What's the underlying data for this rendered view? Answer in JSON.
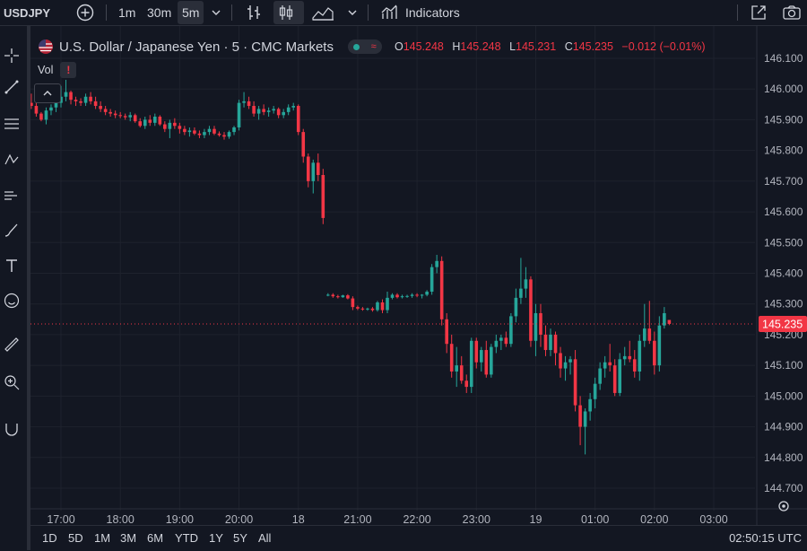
{
  "toolbar": {
    "symbol": "USDJPY",
    "intervals": [
      "1m",
      "30m",
      "5m"
    ],
    "active_interval": "5m",
    "indicators_label": "Indicators"
  },
  "legend": {
    "title": "U.S. Dollar / Japanese Yen · 5 · CMC Markets",
    "o_label": "O",
    "o": "145.248",
    "h_label": "H",
    "h": "145.248",
    "l_label": "L",
    "l": "145.231",
    "c_label": "C",
    "c": "145.235",
    "change": "−0.012 (−0.01%)",
    "vol_label": "Vol",
    "vol_alert": "!"
  },
  "bottom": {
    "ranges": [
      "1D",
      "5D",
      "1M",
      "3M",
      "6M",
      "YTD",
      "1Y",
      "5Y",
      "All"
    ],
    "clock": "02:50:15 UTC"
  },
  "colors": {
    "up": "#26a69a",
    "down": "#f23645",
    "background": "#131722",
    "grid": "#1e222d",
    "price_line": "#f23645"
  },
  "chart_data": {
    "type": "candlestick",
    "ylim": [
      144.7,
      146.1
    ],
    "yticks": [
      "146.100",
      "146.000",
      "145.900",
      "145.800",
      "145.700",
      "145.600",
      "145.500",
      "145.400",
      "145.300",
      "145.200",
      "145.100",
      "145.000",
      "144.900",
      "144.800",
      "144.700"
    ],
    "xticks": [
      "17:00",
      "18:00",
      "19:00",
      "20:00",
      "18",
      "21:00",
      "22:00",
      "23:00",
      "19",
      "01:00",
      "02:00",
      "03:00"
    ],
    "last_price": "145.235",
    "candles": [
      [
        "16:30",
        145.955,
        145.985,
        145.935,
        145.945
      ],
      [
        "16:35",
        145.945,
        145.96,
        145.91,
        145.92
      ],
      [
        "16:40",
        145.92,
        145.925,
        145.895,
        145.9
      ],
      [
        "16:45",
        145.9,
        145.94,
        145.885,
        145.93
      ],
      [
        "16:50",
        145.93,
        145.95,
        145.915,
        145.94
      ],
      [
        "16:55",
        145.94,
        145.965,
        145.925,
        145.955
      ],
      [
        "17:00",
        145.955,
        146.01,
        145.94,
        145.975
      ],
      [
        "17:05",
        145.975,
        146.03,
        145.96,
        145.99
      ],
      [
        "17:10",
        145.99,
        145.995,
        145.95,
        145.965
      ],
      [
        "17:15",
        145.965,
        145.975,
        145.945,
        145.96
      ],
      [
        "17:20",
        145.96,
        145.97,
        145.945,
        145.955
      ],
      [
        "17:25",
        145.955,
        145.985,
        145.945,
        145.975
      ],
      [
        "17:30",
        145.975,
        145.99,
        145.95,
        145.96
      ],
      [
        "17:35",
        145.96,
        145.975,
        145.935,
        145.945
      ],
      [
        "17:40",
        145.945,
        145.96,
        145.925,
        145.935
      ],
      [
        "17:45",
        145.935,
        145.945,
        145.915,
        145.925
      ],
      [
        "17:50",
        145.925,
        145.935,
        145.91,
        145.92
      ],
      [
        "17:55",
        145.92,
        145.93,
        145.905,
        145.915
      ],
      [
        "18:00",
        145.915,
        145.925,
        145.905,
        145.912
      ],
      [
        "18:05",
        145.912,
        145.92,
        145.9,
        145.908
      ],
      [
        "18:10",
        145.908,
        145.925,
        145.895,
        145.915
      ],
      [
        "18:15",
        145.915,
        145.92,
        145.89,
        145.895
      ],
      [
        "18:20",
        145.895,
        145.905,
        145.875,
        145.88
      ],
      [
        "18:25",
        145.88,
        145.91,
        145.87,
        145.9
      ],
      [
        "18:30",
        145.9,
        145.915,
        145.88,
        145.89
      ],
      [
        "18:35",
        145.89,
        145.92,
        145.88,
        145.91
      ],
      [
        "18:40",
        145.91,
        145.915,
        145.88,
        145.885
      ],
      [
        "18:45",
        145.885,
        145.895,
        145.86,
        145.87
      ],
      [
        "18:50",
        145.87,
        145.9,
        145.84,
        145.89
      ],
      [
        "18:55",
        145.89,
        145.905,
        145.87,
        145.88
      ],
      [
        "19:00",
        145.88,
        145.89,
        145.855,
        145.87
      ],
      [
        "19:05",
        145.87,
        145.88,
        145.85,
        145.86
      ],
      [
        "19:10",
        145.86,
        145.875,
        145.845,
        145.865
      ],
      [
        "19:15",
        145.865,
        145.875,
        145.85,
        145.855
      ],
      [
        "19:20",
        145.855,
        145.865,
        145.84,
        145.85
      ],
      [
        "19:25",
        145.85,
        145.87,
        145.84,
        145.86
      ],
      [
        "19:30",
        145.86,
        145.88,
        145.85,
        145.87
      ],
      [
        "19:35",
        145.87,
        145.88,
        145.85,
        145.855
      ],
      [
        "19:40",
        145.855,
        145.862,
        145.845,
        145.85
      ],
      [
        "19:45",
        145.85,
        145.86,
        145.835,
        145.845
      ],
      [
        "19:50",
        145.845,
        145.865,
        145.838,
        145.86
      ],
      [
        "19:55",
        145.86,
        145.88,
        145.85,
        145.875
      ],
      [
        "20:00",
        145.875,
        145.965,
        145.865,
        145.955
      ],
      [
        "20:05",
        145.955,
        145.99,
        145.94,
        145.96
      ],
      [
        "20:10",
        145.96,
        145.975,
        145.935,
        145.945
      ],
      [
        "20:15",
        145.945,
        145.96,
        145.91,
        145.92
      ],
      [
        "20:20",
        145.92,
        145.945,
        145.9,
        145.935
      ],
      [
        "20:25",
        145.935,
        145.95,
        145.915,
        145.925
      ],
      [
        "20:30",
        145.925,
        145.94,
        145.91,
        145.93
      ],
      [
        "20:35",
        145.93,
        145.945,
        145.92,
        145.935
      ],
      [
        "20:40",
        145.935,
        145.94,
        145.905,
        145.915
      ],
      [
        "20:45",
        145.915,
        145.935,
        145.905,
        145.925
      ],
      [
        "20:50",
        145.925,
        145.95,
        145.915,
        145.94
      ],
      [
        "20:55",
        145.94,
        145.955,
        145.93,
        145.945
      ],
      [
        "21:00",
        145.945,
        145.95,
        145.85,
        145.86
      ],
      [
        "21:05",
        145.86,
        145.87,
        145.76,
        145.78
      ],
      [
        "21:10",
        145.78,
        145.79,
        145.68,
        145.7
      ],
      [
        "21:15",
        145.7,
        145.77,
        145.66,
        145.76
      ],
      [
        "21:20",
        145.76,
        145.79,
        145.7,
        145.72
      ],
      [
        "21:25",
        145.72,
        145.74,
        145.56,
        145.58
      ],
      [
        "21:30",
        145.33,
        145.335,
        145.325,
        145.33
      ],
      [
        "21:35",
        145.33,
        145.335,
        145.32,
        145.325
      ],
      [
        "21:40",
        145.325,
        145.33,
        145.318,
        145.322
      ],
      [
        "21:45",
        145.322,
        145.33,
        145.32,
        145.328
      ],
      [
        "21:50",
        145.328,
        145.332,
        145.315,
        145.318
      ],
      [
        "21:55",
        145.318,
        145.325,
        145.28,
        145.29
      ],
      [
        "22:00",
        145.29,
        145.295,
        145.28,
        145.285
      ],
      [
        "22:05",
        145.285,
        145.29,
        145.278,
        145.282
      ],
      [
        "22:10",
        145.282,
        145.288,
        145.278,
        145.285
      ],
      [
        "22:15",
        145.285,
        145.29,
        145.275,
        145.28
      ],
      [
        "22:20",
        145.28,
        145.31,
        145.275,
        145.305
      ],
      [
        "22:25",
        145.305,
        145.315,
        145.27,
        145.28
      ],
      [
        "22:30",
        145.28,
        145.34,
        145.27,
        145.32
      ],
      [
        "22:35",
        145.32,
        145.335,
        145.315,
        145.33
      ],
      [
        "22:40",
        145.33,
        145.335,
        145.318,
        145.322
      ],
      [
        "22:45",
        145.322,
        145.33,
        145.318,
        145.325
      ],
      [
        "22:50",
        145.325,
        145.33,
        145.32,
        145.326
      ],
      [
        "22:55",
        145.326,
        145.335,
        145.32,
        145.33
      ],
      [
        "23:00",
        145.33,
        145.335,
        145.322,
        145.328
      ],
      [
        "23:05",
        145.328,
        145.332,
        145.318,
        145.33
      ],
      [
        "23:10",
        145.33,
        145.345,
        145.325,
        145.34
      ],
      [
        "23:15",
        145.34,
        145.43,
        145.33,
        145.42
      ],
      [
        "23:20",
        145.42,
        145.46,
        145.4,
        145.44
      ],
      [
        "23:25",
        145.44,
        145.455,
        145.23,
        145.25
      ],
      [
        "23:30",
        145.25,
        145.27,
        145.14,
        145.17
      ],
      [
        "23:35",
        145.17,
        145.2,
        145.06,
        145.08
      ],
      [
        "23:40",
        145.08,
        145.16,
        145.03,
        145.1
      ],
      [
        "23:45",
        145.1,
        145.13,
        145.04,
        145.05
      ],
      [
        "23:50",
        145.05,
        145.07,
        145.01,
        145.03
      ],
      [
        "23:55",
        145.03,
        145.19,
        145.01,
        145.18
      ],
      [
        "00:00",
        145.18,
        145.19,
        145.09,
        145.11
      ],
      [
        "00:05",
        145.11,
        145.16,
        145.08,
        145.15
      ],
      [
        "00:10",
        145.15,
        145.18,
        145.06,
        145.07
      ],
      [
        "00:15",
        145.07,
        145.17,
        145.06,
        145.16
      ],
      [
        "00:20",
        145.16,
        145.2,
        145.14,
        145.18
      ],
      [
        "00:25",
        145.18,
        145.2,
        145.15,
        145.19
      ],
      [
        "00:30",
        145.19,
        145.21,
        145.16,
        145.17
      ],
      [
        "00:35",
        145.17,
        145.27,
        145.16,
        145.26
      ],
      [
        "00:40",
        145.26,
        145.35,
        145.24,
        145.32
      ],
      [
        "00:45",
        145.32,
        145.45,
        145.3,
        145.35
      ],
      [
        "00:50",
        145.35,
        145.42,
        145.32,
        145.38
      ],
      [
        "00:55",
        145.38,
        145.39,
        145.16,
        145.18
      ],
      [
        "01:00",
        145.18,
        145.3,
        145.13,
        145.27
      ],
      [
        "01:05",
        145.27,
        145.3,
        145.16,
        145.2
      ],
      [
        "01:10",
        145.2,
        145.23,
        145.13,
        145.15
      ],
      [
        "01:15",
        145.15,
        145.22,
        145.13,
        145.2
      ],
      [
        "01:20",
        145.2,
        145.21,
        145.1,
        145.14
      ],
      [
        "01:25",
        145.14,
        145.16,
        145.06,
        145.09
      ],
      [
        "01:30",
        145.09,
        145.13,
        145.05,
        145.11
      ],
      [
        "01:35",
        145.11,
        145.13,
        145.07,
        145.12
      ],
      [
        "01:40",
        145.12,
        145.15,
        144.95,
        144.97
      ],
      [
        "01:45",
        144.97,
        145.0,
        144.84,
        144.9
      ],
      [
        "01:50",
        144.9,
        144.96,
        144.81,
        144.95
      ],
      [
        "01:55",
        144.95,
        145.01,
        144.92,
        144.99
      ],
      [
        "02:00",
        144.99,
        145.06,
        144.96,
        145.04
      ],
      [
        "02:05",
        145.04,
        145.11,
        145.02,
        145.09
      ],
      [
        "02:10",
        145.09,
        145.13,
        145.06,
        145.11
      ],
      [
        "02:15",
        145.11,
        145.17,
        145.08,
        145.1
      ],
      [
        "02:20",
        145.1,
        145.12,
        145.0,
        145.01
      ],
      [
        "02:25",
        145.01,
        145.14,
        145.0,
        145.12
      ],
      [
        "02:30",
        145.12,
        145.16,
        145.1,
        145.13
      ],
      [
        "02:35",
        145.13,
        145.18,
        145.11,
        145.12
      ],
      [
        "02:40",
        145.12,
        145.15,
        145.06,
        145.08
      ],
      [
        "02:45",
        145.08,
        145.2,
        145.05,
        145.18
      ],
      [
        "02:50",
        145.18,
        145.3,
        145.16,
        145.22
      ],
      [
        "02:55",
        145.22,
        145.31,
        145.17,
        145.18
      ],
      [
        "03:00",
        145.18,
        145.21,
        145.07,
        145.1
      ],
      [
        "03:05",
        145.1,
        145.26,
        145.08,
        145.23
      ],
      [
        "03:10",
        145.23,
        145.29,
        145.22,
        145.27
      ],
      [
        "03:15",
        145.248,
        145.248,
        145.231,
        145.235
      ]
    ]
  }
}
